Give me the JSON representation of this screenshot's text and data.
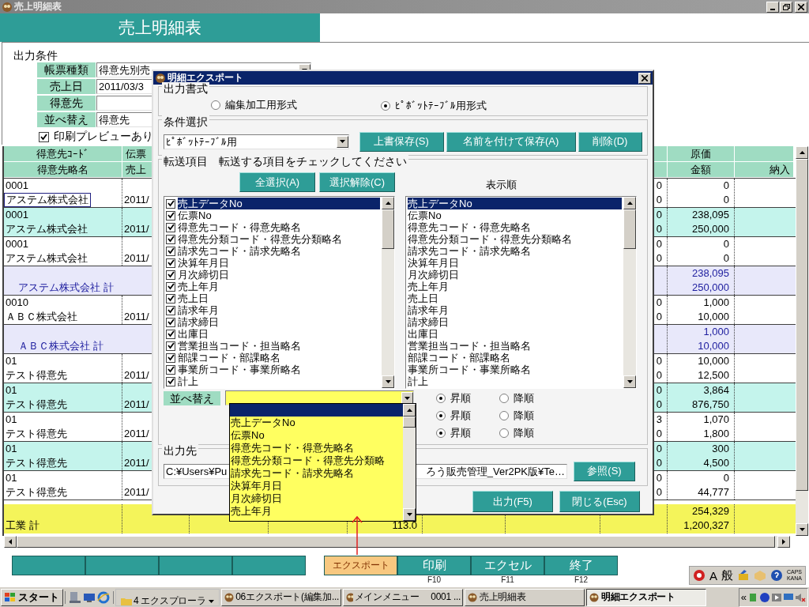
{
  "window": {
    "title": "売上明細表"
  },
  "header": {
    "title": "売上明細表"
  },
  "conditions": {
    "heading": "出力条件",
    "fields": [
      {
        "label": "帳票種類",
        "value": "得意先別売",
        "kind": "combo"
      },
      {
        "label": "売上日",
        "value": "2011/03/3",
        "kind": "text"
      },
      {
        "label": "得意先",
        "kind": "text"
      },
      {
        "label": "並べ替え",
        "value": "得意先",
        "kind": "text"
      }
    ],
    "preview": {
      "label": "印刷プレビューあり",
      "checked": true
    }
  },
  "table": {
    "columns": [
      {
        "line1": "得意先ｺｰﾄﾞ",
        "line2": "得意先略名"
      },
      {
        "line1": "伝票",
        "line2": "売上"
      },
      {
        "line1": "原価",
        "line2": "金額"
      },
      {
        "line2": "納入"
      }
    ],
    "rows": [
      {
        "kind": "detail",
        "shaded": false,
        "focused": true,
        "code": "0001",
        "name": "アステム株式会社",
        "date": "2011/",
        "qty": [
          "0",
          "0"
        ],
        "amount": [
          "0",
          "0"
        ]
      },
      {
        "kind": "detail",
        "shaded": true,
        "focused": false,
        "code": "0001",
        "name": "アステム株式会社",
        "date": "2011/",
        "qty": [
          "0",
          "0"
        ],
        "amount": [
          "238,095",
          "250,000"
        ]
      },
      {
        "kind": "detail",
        "shaded": false,
        "focused": false,
        "code": "0001",
        "name": "アステム株式会社",
        "date": "2011/",
        "qty": [
          "0",
          "0"
        ],
        "amount": [
          "0",
          "0"
        ]
      },
      {
        "kind": "subtotal",
        "name": "アステム株式会社 計",
        "amount": [
          "238,095",
          "250,000"
        ]
      },
      {
        "kind": "detail",
        "shaded": false,
        "focused": false,
        "code": "0010",
        "name": "ＡＢＣ株式会社",
        "date": "2011/",
        "qty": [
          "0",
          "0"
        ],
        "amount": [
          "1,000",
          "10,000"
        ]
      },
      {
        "kind": "subtotal",
        "name": "ＡＢＣ株式会社 計",
        "amount": [
          "1,000",
          "10,000"
        ]
      },
      {
        "kind": "detail",
        "shaded": false,
        "focused": false,
        "code": "01",
        "name": "テスト得意先",
        "date": "2011/",
        "qty": [
          "0",
          "0"
        ],
        "amount": [
          "10,000",
          "12,500"
        ]
      },
      {
        "kind": "detail",
        "shaded": true,
        "focused": false,
        "code": "01",
        "name": "テスト得意先",
        "date": "2011/",
        "qty": [
          "0",
          "0"
        ],
        "amount": [
          "3,864",
          "876,750"
        ]
      },
      {
        "kind": "detail",
        "shaded": false,
        "focused": false,
        "code": "01",
        "name": "テスト得意先",
        "date": "2011/",
        "qty": [
          "3",
          "0"
        ],
        "amount": [
          "1,070",
          "1,800"
        ]
      },
      {
        "kind": "detail",
        "shaded": true,
        "focused": false,
        "code": "01",
        "name": "テスト得意先",
        "date": "2011/",
        "qty": [
          "0",
          "0"
        ],
        "amount": [
          "300",
          "4,500"
        ]
      },
      {
        "kind": "detail",
        "shaded": false,
        "focused": false,
        "code": "01",
        "name": "テスト得意先",
        "date": "2011/",
        "qty": [
          "0",
          "0"
        ],
        "amount": [
          "0",
          "44,777"
        ]
      }
    ],
    "total": {
      "name": "工業 計",
      "figure": "113.0",
      "amount": [
        "254,329",
        "1,200,327"
      ]
    }
  },
  "function_keys": [
    {
      "highlighted": false
    },
    {
      "highlighted": false
    },
    {
      "highlighted": false
    },
    {
      "highlighted": false
    },
    {
      "label": "エクスポート",
      "highlighted": true
    },
    {
      "label": "印刷",
      "key": "F10",
      "highlighted": false
    },
    {
      "label": "エクセル",
      "key": "F11",
      "highlighted": false
    },
    {
      "label": "終了",
      "key": "F12",
      "highlighted": false
    }
  ],
  "ime_bar": {
    "mode": "A",
    "input": "般",
    "caps": "CAPS",
    "kana": "KANA"
  },
  "taskbar": {
    "start": "スタート",
    "tasks": [
      {
        "label": "4 エクスプローラ",
        "kind": "group",
        "selected": false
      },
      {
        "label": "06エクスポート(編集加...",
        "kind": "window",
        "selected": false
      },
      {
        "label": "メインメニュー　 0001 ...",
        "kind": "window",
        "selected": false
      },
      {
        "label": "売上明細表",
        "kind": "window",
        "selected": false
      },
      {
        "label": "明細エクスポート",
        "kind": "window",
        "selected": true
      }
    ],
    "tray": "«"
  },
  "dialog": {
    "title": "明細エクスポート",
    "output_format": {
      "legend": "出力書式",
      "options": [
        {
          "label": "編集加工用形式",
          "selected": false
        },
        {
          "label": "ﾋﾟﾎﾞｯﾄﾃｰﾌﾞﾙ用形式",
          "selected": true
        }
      ]
    },
    "condition": {
      "legend": "条件選択",
      "value": "ﾋﾟﾎﾞｯﾄﾃｰﾌﾞﾙ用",
      "buttons": [
        "上書保存(S)",
        "名前を付けて保存(A)",
        "削除(D)"
      ]
    },
    "transfer": {
      "legend": "転送項目　転送する項目をチェックしてください",
      "buttons": [
        "全選択(A)",
        "選択解除(C)"
      ],
      "order_label": "表示順",
      "items": [
        {
          "label": "売上データNo",
          "checked": true,
          "selected": true
        },
        {
          "label": "伝票No",
          "checked": true,
          "selected": false
        },
        {
          "label": "得意先コード・得意先略名",
          "checked": true,
          "selected": false
        },
        {
          "label": "得意先分類コード・得意先分類略名",
          "checked": true,
          "selected": false
        },
        {
          "label": "請求先コード・請求先略名",
          "checked": true,
          "selected": false
        },
        {
          "label": "決算年月日",
          "checked": true,
          "selected": false
        },
        {
          "label": "月次締切日",
          "checked": true,
          "selected": false
        },
        {
          "label": "売上年月",
          "checked": true,
          "selected": false
        },
        {
          "label": "売上日",
          "checked": true,
          "selected": false
        },
        {
          "label": "請求年月",
          "checked": true,
          "selected": false
        },
        {
          "label": "請求締日",
          "checked": true,
          "selected": false
        },
        {
          "label": "出庫日",
          "checked": true,
          "selected": false
        },
        {
          "label": "営業担当コード・担当略名",
          "checked": true,
          "selected": false
        },
        {
          "label": "部課コード・部課略名",
          "checked": true,
          "selected": false
        },
        {
          "label": "事業所コード・事業所略名",
          "checked": true,
          "selected": false
        },
        {
          "label": "計上",
          "checked": true,
          "selected": false
        }
      ],
      "order": [
        {
          "label": "売上データNo",
          "selected": true
        },
        {
          "label": "伝票No",
          "selected": false
        },
        {
          "label": "得意先コード・得意先略名",
          "selected": false
        },
        {
          "label": "得意先分類コード・得意先分類略名",
          "selected": false
        },
        {
          "label": "請求先コード・請求先略名",
          "selected": false
        },
        {
          "label": "決算年月日",
          "selected": false
        },
        {
          "label": "月次締切日",
          "selected": false
        },
        {
          "label": "売上年月",
          "selected": false
        },
        {
          "label": "売上日",
          "selected": false
        },
        {
          "label": "請求年月",
          "selected": false
        },
        {
          "label": "請求締日",
          "selected": false
        },
        {
          "label": "出庫日",
          "selected": false
        },
        {
          "label": "営業担当コード・担当略名",
          "selected": false
        },
        {
          "label": "部課コード・部課略名",
          "selected": false
        },
        {
          "label": "事業所コード・事業所略名",
          "selected": false
        },
        {
          "label": "計上",
          "selected": false
        }
      ]
    },
    "sort": {
      "rows": [
        {
          "label": "並べ替え",
          "options": [
            {
              "label": "昇順",
              "selected": true
            },
            {
              "label": "降順",
              "selected": false
            }
          ]
        },
        {
          "options": [
            {
              "label": "昇順",
              "selected": true
            },
            {
              "label": "降順",
              "selected": false
            }
          ]
        },
        {
          "options": [
            {
              "label": "昇順",
              "selected": true
            },
            {
              "label": "降順",
              "selected": false
            }
          ]
        }
      ]
    },
    "output": {
      "legend": "出力先",
      "path_start": "C:¥Users¥Pu",
      "path_end": "ろう販売管理_Ver2PK版¥Te…",
      "browse": "参照(S)"
    },
    "buttons": [
      "出力(F5)",
      "閉じる(Esc)"
    ]
  },
  "dropdown": {
    "items": [
      {
        "selected": true
      },
      {
        "label": "売上データNo",
        "selected": false
      },
      {
        "label": "伝票No",
        "selected": false
      },
      {
        "label": "得意先コード・得意先略名",
        "selected": false
      },
      {
        "label": "得意先分類コード・得意先分類略",
        "selected": false
      },
      {
        "label": "請求先コード・請求先略名",
        "selected": false
      },
      {
        "label": "決算年月日",
        "selected": false
      },
      {
        "label": "月次締切日",
        "selected": false
      },
      {
        "label": "売上年月",
        "selected": false
      }
    ]
  }
}
